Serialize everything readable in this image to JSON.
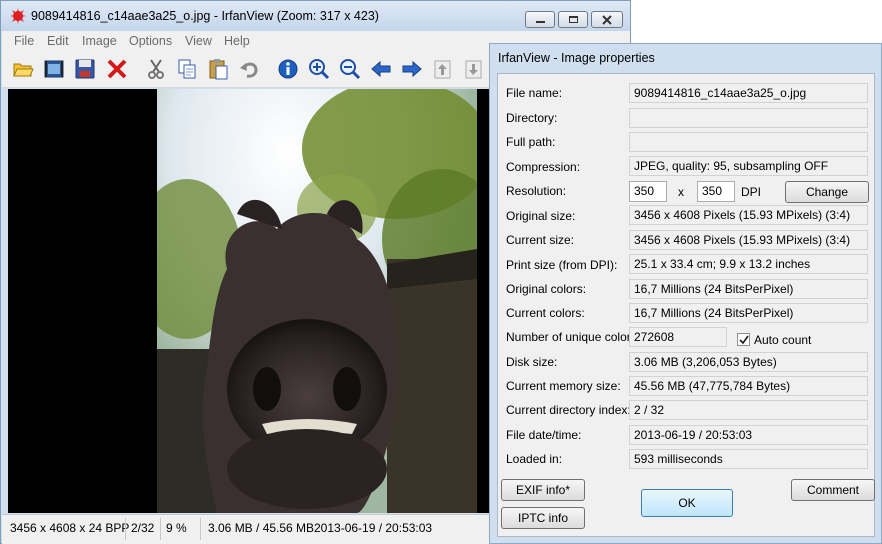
{
  "main_window": {
    "title": "9089414816_c14aae3a25_o.jpg - IrfanView (Zoom: 317 x 423)",
    "menu": [
      "File",
      "Edit",
      "Image",
      "Options",
      "View",
      "Help"
    ],
    "toolbar_icons": [
      "open-folder-icon",
      "slideshow-icon",
      "save-icon",
      "delete-icon",
      "cut-icon",
      "copy-icon",
      "paste-icon",
      "undo-icon",
      "info-icon",
      "zoom-in-icon",
      "zoom-out-icon",
      "previous-arrow-icon",
      "next-arrow-icon",
      "previous-file-icon",
      "next-file-icon"
    ],
    "status": {
      "dimensions": "3456 x 4608 x 24 BPP",
      "index": "2/32",
      "zoom": "9 %",
      "sizes": "3.06 MB / 45.56 MB",
      "datetime": "2013-06-19 / 20:53:03"
    }
  },
  "dialog": {
    "title": "IrfanView - Image properties",
    "rows": {
      "file_name": {
        "label": "File name:",
        "value": "9089414816_c14aae3a25_o.jpg"
      },
      "directory": {
        "label": "Directory:",
        "value": ""
      },
      "full_path": {
        "label": "Full path:",
        "value": ""
      },
      "compression": {
        "label": "Compression:",
        "value": "JPEG, quality: 95, subsampling OFF"
      },
      "resolution": {
        "label": "Resolution:",
        "x_value": "350",
        "separator": "x",
        "y_value": "350",
        "unit": "DPI",
        "change_button": "Change"
      },
      "original_size": {
        "label": "Original size:",
        "value": "3456 x 4608  Pixels (15.93 MPixels) (3:4)"
      },
      "current_size": {
        "label": "Current size:",
        "value": "3456 x 4608  Pixels (15.93 MPixels) (3:4)"
      },
      "print_size": {
        "label": "Print size (from DPI):",
        "value": "25.1 x 33.4 cm; 9.9 x 13.2 inches"
      },
      "original_colors": {
        "label": "Original colors:",
        "value": "16,7 Millions   (24 BitsPerPixel)"
      },
      "current_colors": {
        "label": "Current colors:",
        "value": "16,7 Millions   (24 BitsPerPixel)"
      },
      "unique_colors": {
        "label": "Number of unique colors:",
        "value": "272608",
        "auto_count_label": "Auto count",
        "auto_count_checked": true
      },
      "disk_size": {
        "label": "Disk size:",
        "value": "3.06 MB (3,206,053 Bytes)"
      },
      "memory_size": {
        "label": "Current memory size:",
        "value": "45.56  MB (47,775,784 Bytes)"
      },
      "dir_index": {
        "label": "Current directory index:",
        "value": "2  /  32"
      },
      "file_datetime": {
        "label": "File date/time:",
        "value": "2013-06-19 / 20:53:03"
      },
      "loaded_in": {
        "label": "Loaded in:",
        "value": "593 milliseconds"
      }
    },
    "buttons": {
      "exif": "EXIF info*",
      "iptc": "IPTC info",
      "ok": "OK",
      "comment": "Comment"
    }
  }
}
